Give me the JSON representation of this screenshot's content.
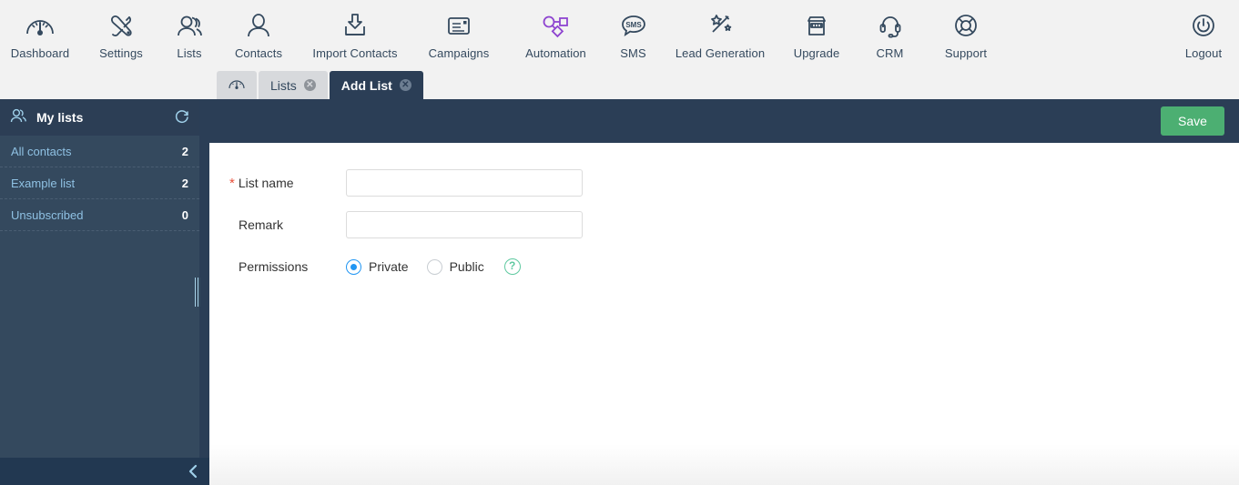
{
  "toolbar": {
    "items": [
      {
        "label": "Dashboard",
        "icon": "gauge-icon"
      },
      {
        "label": "Settings",
        "icon": "tools-icon"
      },
      {
        "label": "Lists",
        "icon": "people-group-icon"
      },
      {
        "label": "Contacts",
        "icon": "person-icon"
      },
      {
        "label": "Import Contacts",
        "icon": "import-inbox-icon"
      },
      {
        "label": "Campaigns",
        "icon": "envelope-letter-icon"
      },
      {
        "label": "Automation",
        "icon": "workflow-nodes-icon"
      },
      {
        "label": "SMS",
        "icon": "sms-bubble-icon"
      },
      {
        "label": "Lead Generation",
        "icon": "magic-wand-icon"
      },
      {
        "label": "Upgrade",
        "icon": "store-icon"
      },
      {
        "label": "CRM",
        "icon": "headset-icon"
      },
      {
        "label": "Support",
        "icon": "lifebuoy-icon"
      }
    ],
    "logout": {
      "label": "Logout",
      "icon": "power-icon"
    },
    "accent_purple": "#8e44d0",
    "icon_color": "#34495e"
  },
  "tabs": [
    {
      "label": "",
      "icon": "gauge-icon",
      "active": false,
      "closable": false
    },
    {
      "label": "Lists",
      "active": false,
      "closable": true
    },
    {
      "label": "Add List",
      "active": true,
      "closable": true
    }
  ],
  "actionbar": {
    "save_label": "Save",
    "save_color": "#4caf72",
    "bar_color": "#2b3e56"
  },
  "sidebar": {
    "title": "My lists",
    "title_icon": "people-group-icon",
    "refresh_icon": "refresh-icon",
    "collapse_icon": "chevron-left-icon",
    "items": [
      {
        "label": "All contacts",
        "count": "2"
      },
      {
        "label": "Example list",
        "count": "2"
      },
      {
        "label": "Unsubscribed",
        "count": "0"
      }
    ]
  },
  "form": {
    "list_name": {
      "label": "List name",
      "required_marker": "*",
      "value": "",
      "placeholder": ""
    },
    "remark": {
      "label": "Remark",
      "value": "",
      "placeholder": ""
    },
    "permissions": {
      "label": "Permissions",
      "options": [
        {
          "label": "Private",
          "selected": true
        },
        {
          "label": "Public",
          "selected": false
        }
      ],
      "help_icon": "question-mark-icon",
      "help_label": "?"
    }
  }
}
